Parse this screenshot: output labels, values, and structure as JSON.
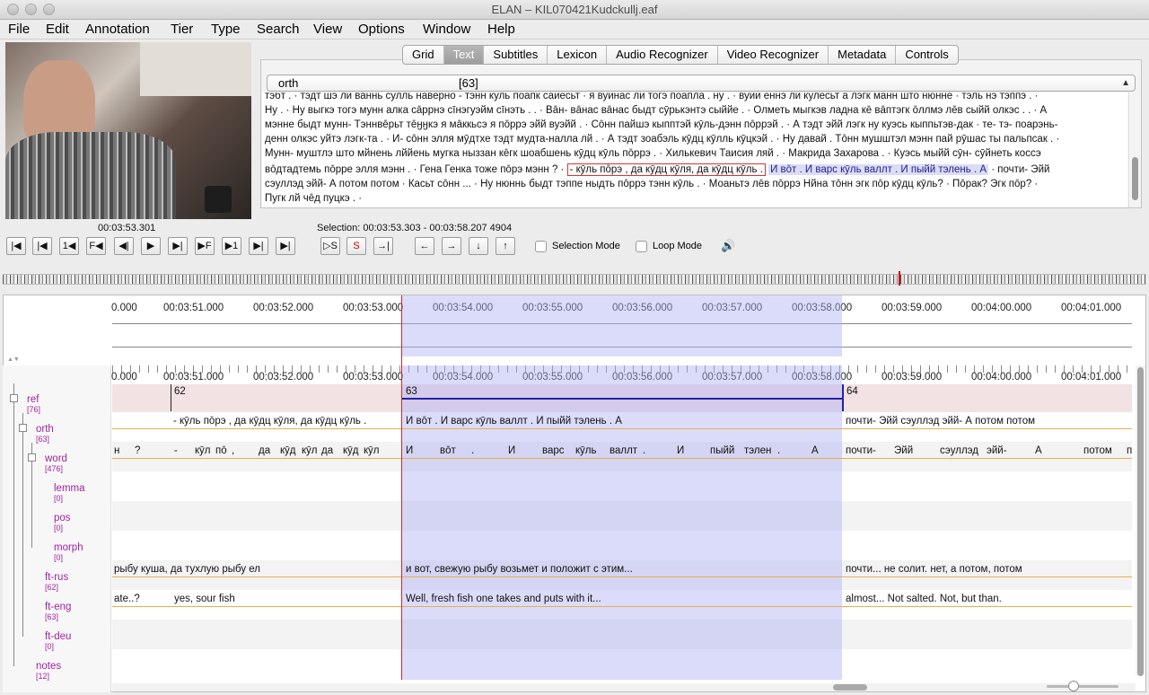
{
  "window": {
    "title": "ELAN – KIL070421Kudckullj.eaf"
  },
  "menu": [
    "File",
    "Edit",
    "Annotation",
    "Tier",
    "Type",
    "Search",
    "View",
    "Options",
    "Window",
    "Help"
  ],
  "tabs": [
    "Grid",
    "Text",
    "Subtitles",
    "Lexicon",
    "Audio Recognizer",
    "Video Recognizer",
    "Metadata",
    "Controls"
  ],
  "active_tab": "Text",
  "text_view": {
    "tier": "orth",
    "count": "[63]",
    "lines": [
      "тэбт .  ·  тэдт шэ ли ваннь сулль наверно - тэнн куль поапк сайесьт  ·  я вуйнас ли тогэ поапла . ну .  ·  вуйи еннэ ли кулесьт а лэгк манн што нюнне  ·  тэль нэ тэппэ .  ·",
      "Ну .  ·  Ну выгкэ тогэ мунн алка сāррнэ сīнэгуэйм сīнэть . .  ·  Вāн- вāнас вāнас быдт сӯрькэнтэ сыййе .  ·  Олметь мыгкэв ладна кē вāптэгк ōллмэ лēв сыйй олкэс . .  ·  А",
      "мэнне быдт мунн- Тэннвēрьт тēӈӈкэ я мāккьсэ я пōррэ эйй вуэйй .  ·  Сōнн пайшэ кыпптэй кӯль-дэнн пōррэй .  ·  А тэдт эйй лэгк ну куэсь кыппьтэв-дак  ·  те- тэ- поарэнь-",
      "денн олкэс уйтэ лэгк-та .  ·  И- сōнн элля мӯдтхе тэдт мудта-налла лй .  ·  А тэдт зоабэль кӯдц кӯлль кӯцкэй .  ·  Ну давай . Тōнн мушштэл мэнн пай рӯшас ты пальпсак .  ·",
      "Мунн- муштлэ што мйнень лййень мугка ныззан кēгк шоабшень кӯдц кӯль пōррэ .  ·  Хилькевич Таисия ляй .  ·  Макрида Захарова .  ·  Куэсь мыйй сӯн- сӯйнеть коссэ",
      "вōдтадтемь пōрре элля мэнн .  ·  Гена Генка тоже пōрэ мэнн ?  · ",
      "сэуллэд эйй- А потом потом  ·  Касьт сōнн ...  ·  Ну нюннь быдт тэппе ныдть пōррэ тэнн кӯль .  ·  Моаньтэ лēв пōррэ Нйна тōнн эгк пōр кӯдц кӯль?  ·  Пōрак? Эгк пōр?  ·",
      "Пугк лй чēд пуцкэ .  ·"
    ],
    "line6_red": "- кӯль пōрэ , да кӯдц кӯля, да кӯдц кӯль .",
    "line6_blue": "И вōт . И варс кӯль валлт . И пыйй тэлень . А",
    "line6_tail": "·  почти- Эйй"
  },
  "player": {
    "media_time": "00:03:53.301",
    "selection": "Selection: 00:03:53.303 - 00:03:58.207  4904",
    "selection_mode": "Selection Mode",
    "loop_mode": "Loop Mode",
    "buttons": [
      "|◀",
      "|◀",
      "1◀",
      "F◀",
      "◀|",
      "▶",
      "▶|",
      "▶F",
      "▶1",
      "▶|",
      "▶|"
    ],
    "sel_buttons": [
      "▷S",
      "S",
      "→|"
    ],
    "nav_buttons": [
      "←",
      "→",
      "↓",
      "↑"
    ]
  },
  "ruler_labels": [
    "0.000",
    "00:03:51.000",
    "00:03:52.000",
    "00:03:53.000",
    "00:03:54.000",
    "00:03:55.000",
    "00:03:56.000",
    "00:03:57.000",
    "00:03:58.000",
    "00:03:59.000",
    "00:04:00.000",
    "00:04:01.000"
  ],
  "tiers": [
    {
      "name": "ref",
      "count": "[76]"
    },
    {
      "name": "orth",
      "count": "[63]"
    },
    {
      "name": "word",
      "count": "[476]"
    },
    {
      "name": "lemma",
      "count": "[0]"
    },
    {
      "name": "pos",
      "count": "[0]"
    },
    {
      "name": "morph",
      "count": "[0]"
    },
    {
      "name": "ft-rus",
      "count": "[62]"
    },
    {
      "name": "ft-eng",
      "count": "[63]"
    },
    {
      "name": "ft-deu",
      "count": "[0]"
    },
    {
      "name": "notes",
      "count": "[12]"
    }
  ],
  "annotations": {
    "ref": [
      "62",
      "63",
      "64"
    ],
    "orth": [
      "- кӯль пōрэ , да кӯдц кӯля, да кӯдц кӯль .",
      "И вōт . И варс кӯль валлт . И пыйй тэлень . А",
      "почти- Эйй сэуллэд эйй- А потом потом"
    ],
    "word": [
      "н",
      "?",
      "-",
      "кӯл",
      "пō",
      ",",
      "да",
      "кӯд",
      "кӯл",
      "да",
      "кӯд",
      "кӯл",
      "И",
      "вōт",
      ".",
      "И",
      "варс",
      "кӯль",
      "валлт",
      ".",
      "И",
      "пыйй",
      "тэлен",
      ".",
      "А",
      "почти-",
      "Эйй",
      "сэуллэд",
      "эйй-",
      "А",
      "потом",
      "п"
    ],
    "ft_rus": [
      "рыбу куша, да тухлую рыбу ел",
      "и вот, свежую рыбу возьмет и положит с этим...",
      "почти... не солит. нет, а потом, потом"
    ],
    "ft_eng": [
      "ate..?",
      "yes, sour fish",
      "Well, fresh fish one takes and puts with it...",
      "almost... Not salted. Not, but than."
    ]
  }
}
